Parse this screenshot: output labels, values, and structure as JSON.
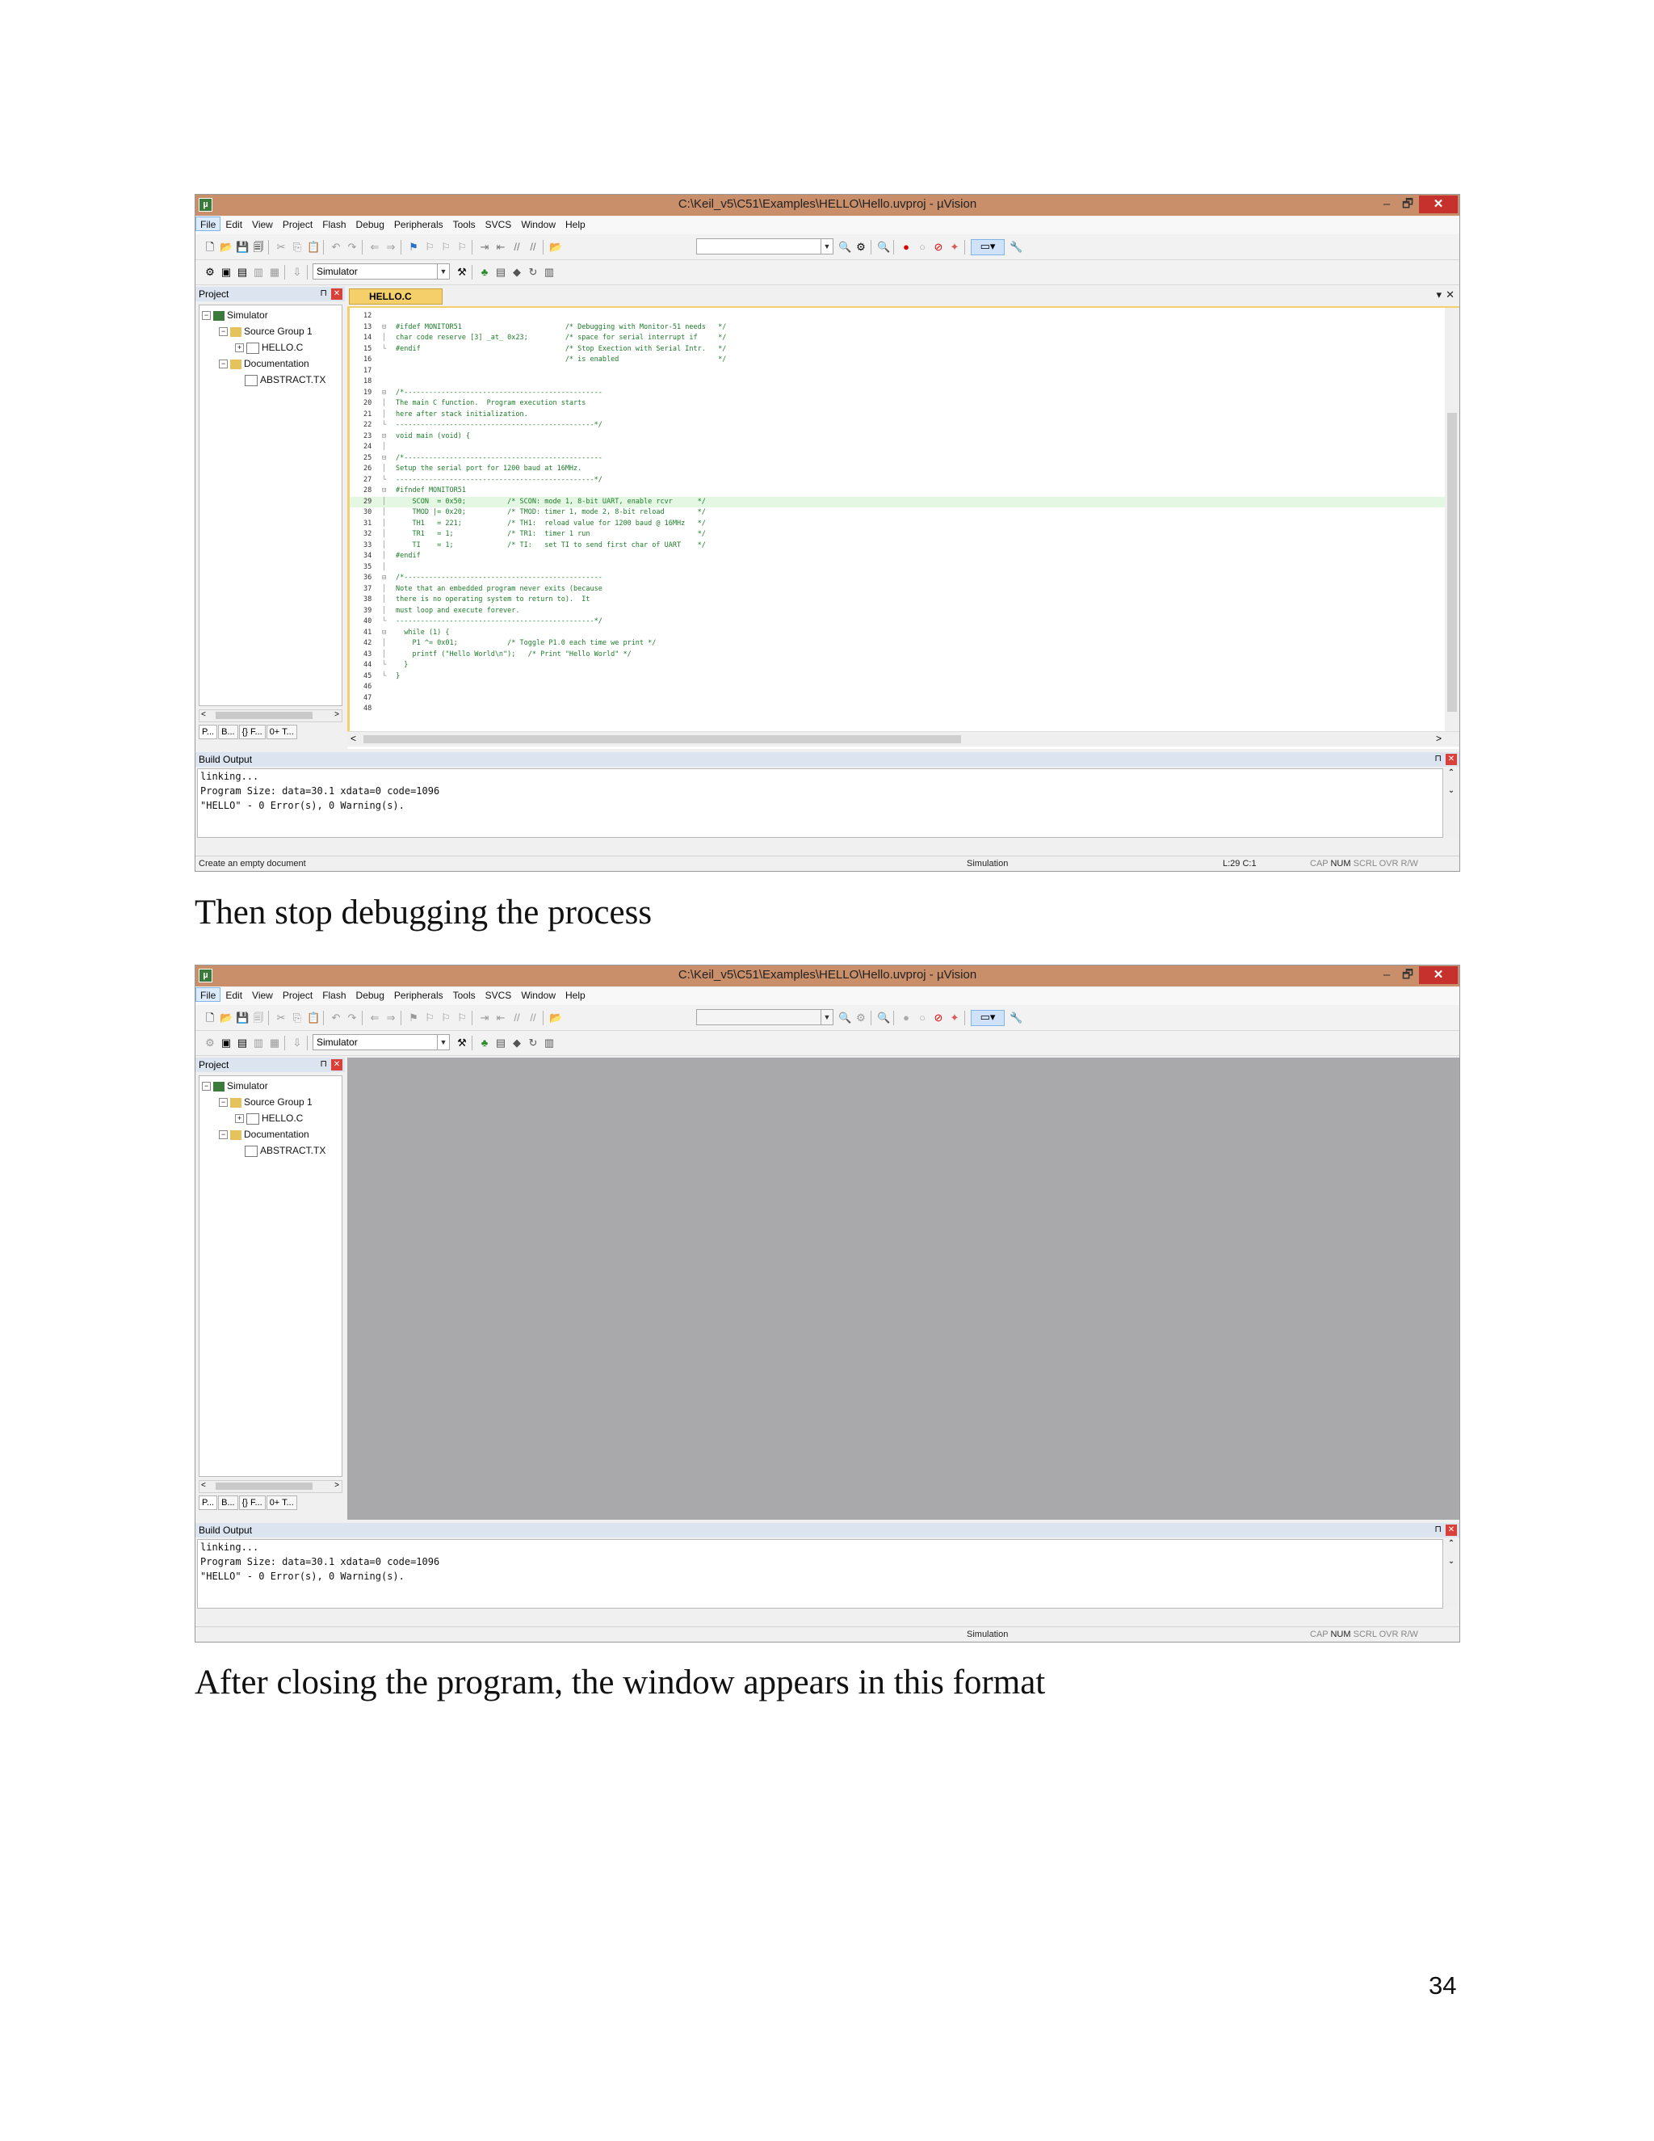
{
  "window": {
    "title": "C:\\Keil_v5\\C51\\Examples\\HELLO\\Hello.uvproj - µVision",
    "min": "–",
    "max": "🗗",
    "close": "✕"
  },
  "menu": [
    "File",
    "Edit",
    "View",
    "Project",
    "Flash",
    "Debug",
    "Peripherals",
    "Tools",
    "SVCS",
    "Window",
    "Help"
  ],
  "toolbar": {
    "target": "Simulator"
  },
  "project_pane": {
    "title": "Project",
    "tree": [
      "Simulator",
      "Source Group 1",
      "HELLO.C",
      "Documentation",
      "ABSTRACT.TX"
    ],
    "tabs": [
      "P...",
      "B...",
      "{} F...",
      "0+ T..."
    ]
  },
  "editor": {
    "tab": "HELLO.C",
    "lines": [
      {
        "n": "12",
        "fold": "",
        "code": ""
      },
      {
        "n": "13",
        "fold": "⊟",
        "code": "#ifdef MONITOR51                         /* Debugging with Monitor-51 needs   */"
      },
      {
        "n": "14",
        "fold": "│",
        "code": "char code reserve [3] _at_ 0x23;         /* space for serial interrupt if     */"
      },
      {
        "n": "15",
        "fold": "└",
        "code": "#endif                                   /* Stop Exection with Serial Intr.   */"
      },
      {
        "n": "16",
        "fold": "",
        "code": "                                         /* is enabled                        */"
      },
      {
        "n": "17",
        "fold": "",
        "code": ""
      },
      {
        "n": "18",
        "fold": "",
        "code": ""
      },
      {
        "n": "19",
        "fold": "⊟",
        "code": "/*------------------------------------------------"
      },
      {
        "n": "20",
        "fold": "│",
        "code": "The main C function.  Program execution starts"
      },
      {
        "n": "21",
        "fold": "│",
        "code": "here after stack initialization."
      },
      {
        "n": "22",
        "fold": "└",
        "code": "------------------------------------------------*/"
      },
      {
        "n": "23",
        "fold": "⊟",
        "code": "void main (void) {"
      },
      {
        "n": "24",
        "fold": "│",
        "code": ""
      },
      {
        "n": "25",
        "fold": "⊟",
        "code": "/*------------------------------------------------"
      },
      {
        "n": "26",
        "fold": "│",
        "code": "Setup the serial port for 1200 baud at 16MHz."
      },
      {
        "n": "27",
        "fold": "└",
        "code": "------------------------------------------------*/"
      },
      {
        "n": "28",
        "fold": "⊟",
        "code": "#ifndef MONITOR51"
      },
      {
        "n": "29",
        "fold": "│",
        "code": "    SCON  = 0x50;          /* SCON: mode 1, 8-bit UART, enable rcvr      */"
      },
      {
        "n": "30",
        "fold": "│",
        "code": "    TMOD |= 0x20;          /* TMOD: timer 1, mode 2, 8-bit reload        */"
      },
      {
        "n": "31",
        "fold": "│",
        "code": "    TH1   = 221;           /* TH1:  reload value for 1200 baud @ 16MHz   */"
      },
      {
        "n": "32",
        "fold": "│",
        "code": "    TR1   = 1;             /* TR1:  timer 1 run                          */"
      },
      {
        "n": "33",
        "fold": "│",
        "code": "    TI    = 1;             /* TI:   set TI to send first char of UART    */"
      },
      {
        "n": "34",
        "fold": "│",
        "code": "#endif"
      },
      {
        "n": "35",
        "fold": "│",
        "code": ""
      },
      {
        "n": "36",
        "fold": "⊟",
        "code": "/*------------------------------------------------"
      },
      {
        "n": "37",
        "fold": "│",
        "code": "Note that an embedded program never exits (because"
      },
      {
        "n": "38",
        "fold": "│",
        "code": "there is no operating system to return to).  It"
      },
      {
        "n": "39",
        "fold": "│",
        "code": "must loop and execute forever."
      },
      {
        "n": "40",
        "fold": "└",
        "code": "------------------------------------------------*/"
      },
      {
        "n": "41",
        "fold": "⊟",
        "code": "  while (1) {"
      },
      {
        "n": "42",
        "fold": "│",
        "code": "    P1 ^= 0x01;            /* Toggle P1.0 each time we print */"
      },
      {
        "n": "43",
        "fold": "│",
        "code": "    printf (\"Hello World\\n\");   /* Print \"Hello World\" */"
      },
      {
        "n": "44",
        "fold": "└",
        "code": "  }"
      },
      {
        "n": "45",
        "fold": "└",
        "code": "}"
      },
      {
        "n": "46",
        "fold": "",
        "code": ""
      },
      {
        "n": "47",
        "fold": "",
        "code": ""
      },
      {
        "n": "48",
        "fold": "",
        "code": ""
      }
    ]
  },
  "build_output": {
    "title": "Build Output",
    "text": "linking...\nProgram Size: data=30.1 xdata=0 code=1096\n\"HELLO\" - 0 Error(s), 0 Warning(s)."
  },
  "status1": {
    "left": "Create an empty document",
    "mode": "Simulation",
    "pos": "L:29 C:1",
    "keys": [
      "CAP",
      "NUM",
      "SCRL",
      "OVR",
      "R/W"
    ]
  },
  "status2": {
    "left": "",
    "mode": "Simulation",
    "pos": "",
    "keys": [
      "CAP",
      "NUM",
      "SCRL",
      "OVR",
      "R/W"
    ]
  },
  "captions": {
    "first": "Then stop debugging the process",
    "second": "After closing the program, the window appears in this format"
  },
  "page_number": "34"
}
